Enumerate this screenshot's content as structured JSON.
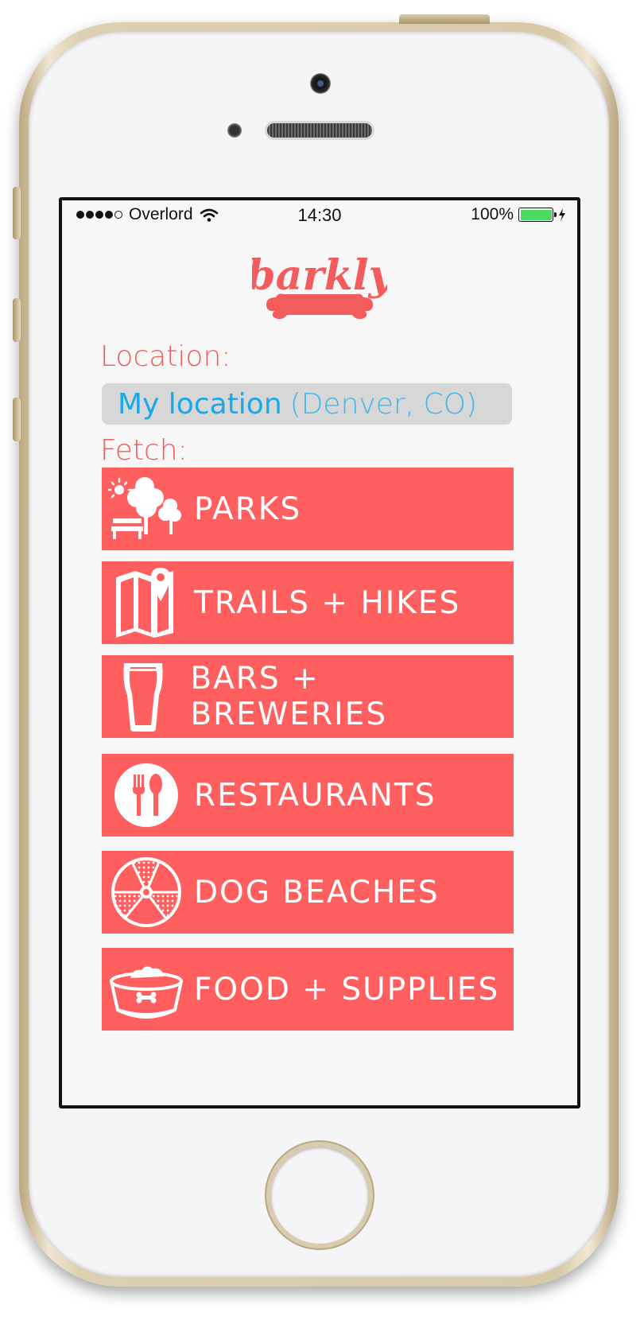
{
  "status_bar": {
    "carrier": "Overlord",
    "time": "14:30",
    "battery_percent": "100%",
    "battery_level": 1.0,
    "signal_bars_filled": 4,
    "signal_bars_total": 5
  },
  "app": {
    "logo_text": "barkly",
    "brand_color": "#ff5f5f"
  },
  "location": {
    "label": "Location:",
    "value": "My location",
    "detail": "(Denver, CO)"
  },
  "fetch": {
    "label": "Fetch:",
    "items": [
      {
        "label": "PARKS",
        "icon": "park-icon"
      },
      {
        "label": "TRAILS + HIKES",
        "icon": "map-pin-icon"
      },
      {
        "label": "BARS + BREWERIES",
        "icon": "beer-glass-icon"
      },
      {
        "label": "RESTAURANTS",
        "icon": "fork-spoon-icon"
      },
      {
        "label": "DOG BEACHES",
        "icon": "beach-ball-icon"
      },
      {
        "label": "FOOD + SUPPLIES",
        "icon": "dog-bowl-icon"
      }
    ]
  }
}
